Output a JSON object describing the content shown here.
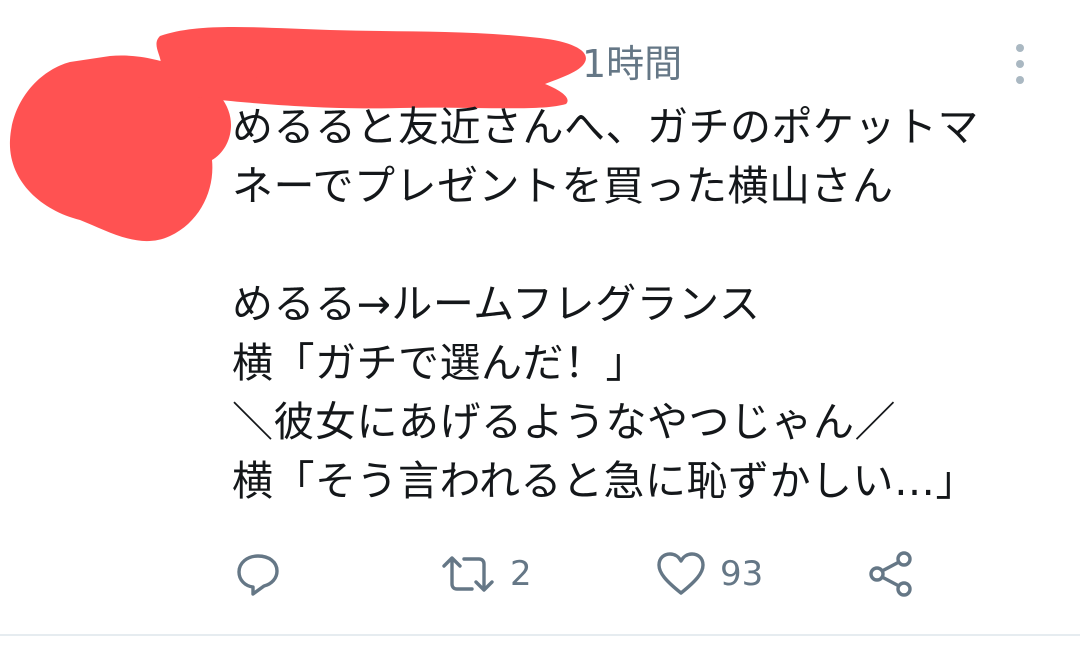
{
  "tweet": {
    "timestamp": "1時間",
    "lines": [
      "めるると友近さんへ、ガチのポケットマ",
      "ネーでプレゼントを買った横山さん",
      "",
      "めるる→ルームフレグランス",
      "横「ガチで選んだ！」",
      "＼彼女にあげるようなやつじゃん／",
      "横「そう言われると急に恥ずかしい…」"
    ],
    "retweet_count": "2",
    "like_count": "93"
  },
  "icons": {
    "reply": "reply-icon",
    "retweet": "retweet-icon",
    "like": "heart-icon",
    "share": "share-icon",
    "more": "more-vertical-icon"
  },
  "colors": {
    "redaction": "#ff5252",
    "meta_text": "#657786",
    "body_text": "#14171a",
    "divider": "#e6ecf0"
  }
}
